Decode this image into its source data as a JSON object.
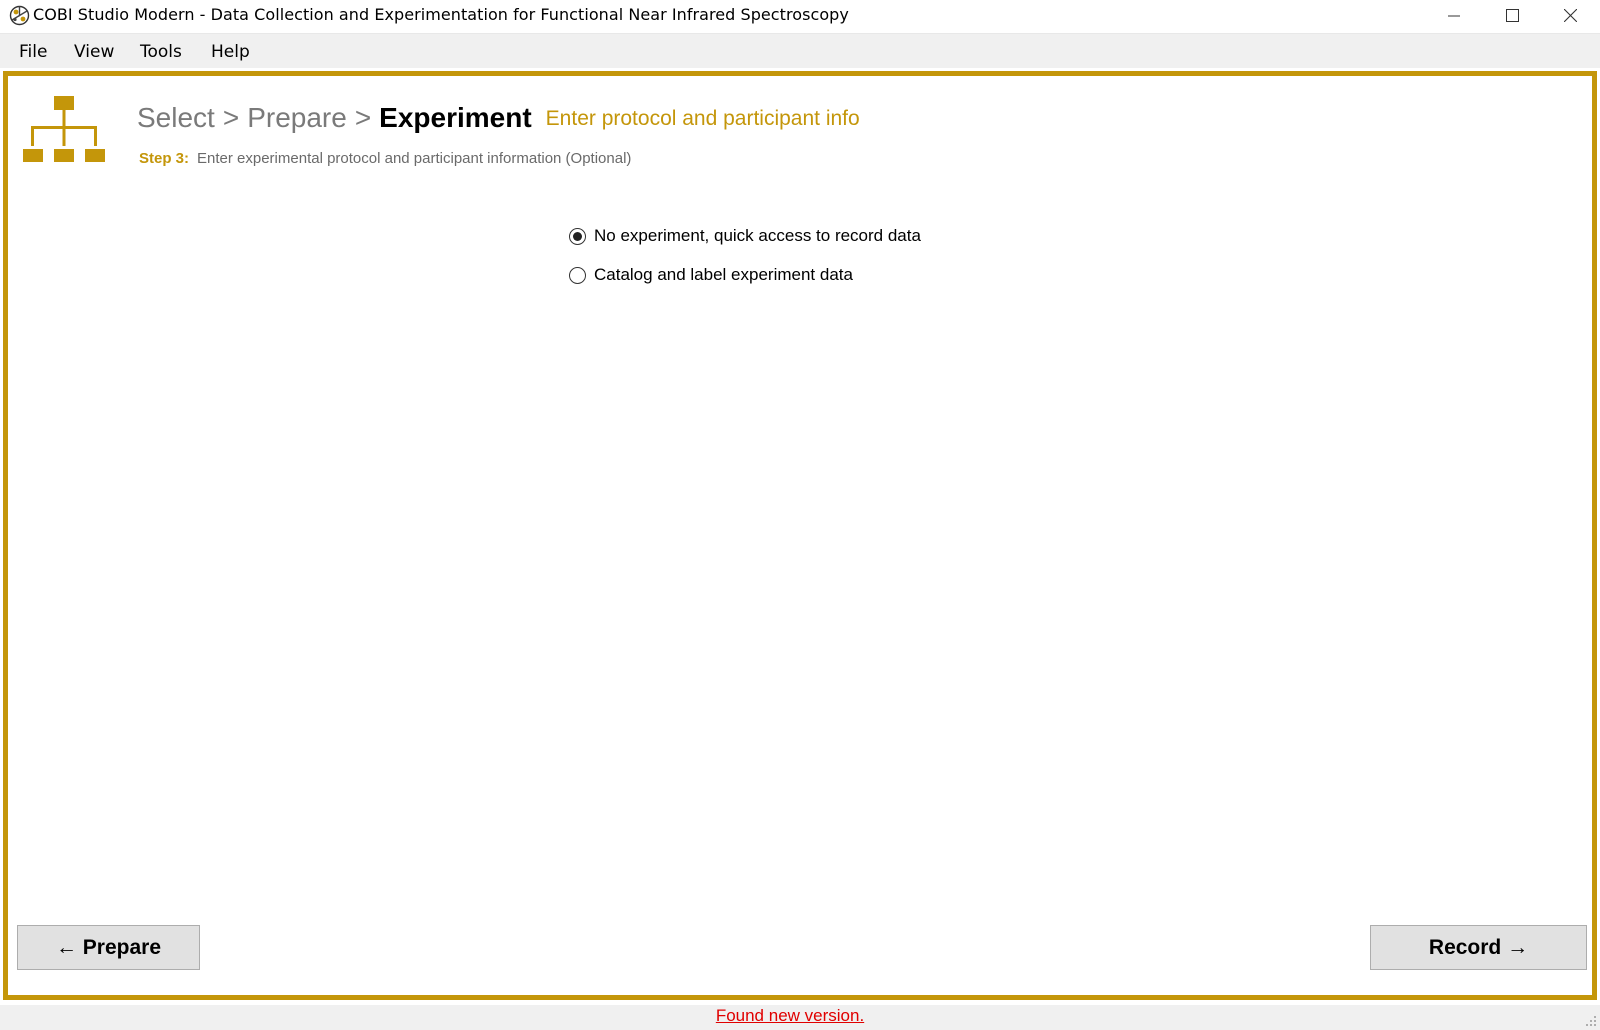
{
  "window": {
    "title": "COBI Studio Modern - Data Collection and Experimentation for Functional Near Infrared Spectroscopy",
    "icon": "cobi-app-icon"
  },
  "menu": {
    "items": [
      {
        "label": "File"
      },
      {
        "label": "View"
      },
      {
        "label": "Tools"
      },
      {
        "label": "Help"
      }
    ]
  },
  "header": {
    "icon": "hierarchy-icon",
    "breadcrumb": {
      "step1": "Select",
      "step2": "Prepare",
      "current": "Experiment",
      "separator": ">"
    },
    "subtitle": "Enter protocol and participant info",
    "step_label": "Step 3:",
    "step_description": "Enter experimental protocol and participant information (Optional)"
  },
  "options": [
    {
      "label": "No experiment, quick access to record data",
      "selected": true
    },
    {
      "label": "Catalog and label experiment data",
      "selected": false
    }
  ],
  "navigation": {
    "back_label": "← Prepare",
    "next_label": "Record →"
  },
  "status": {
    "link_text": "Found new version."
  },
  "colors": {
    "accent": "#c4960a",
    "muted_text": "#7a7a7a",
    "link": "#e00000",
    "button_bg": "#e1e1e1"
  }
}
